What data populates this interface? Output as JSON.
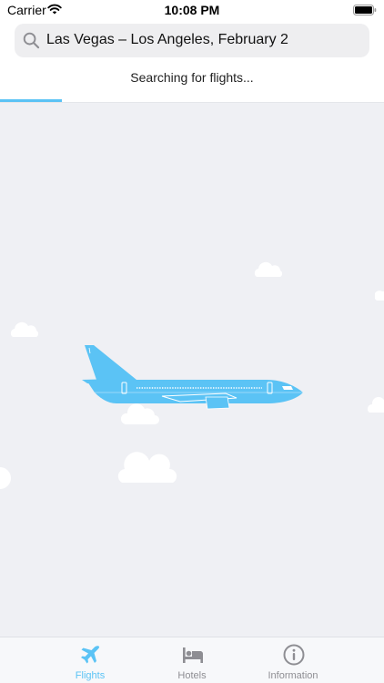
{
  "status_bar": {
    "carrier": "Carrier",
    "time": "10:08 PM"
  },
  "search": {
    "query": "Las Vegas – Los Angeles, February 2"
  },
  "status": {
    "text": "Searching for flights...",
    "progress_fraction": 0.16
  },
  "tabs": [
    {
      "label": "Flights",
      "icon": "airplane-icon",
      "active": true
    },
    {
      "label": "Hotels",
      "icon": "bed-icon",
      "active": false
    },
    {
      "label": "Information",
      "icon": "info-icon",
      "active": false
    }
  ],
  "colors": {
    "accent": "#5bc3f5",
    "background": "#eff0f4",
    "inactive": "#8e8e93"
  }
}
